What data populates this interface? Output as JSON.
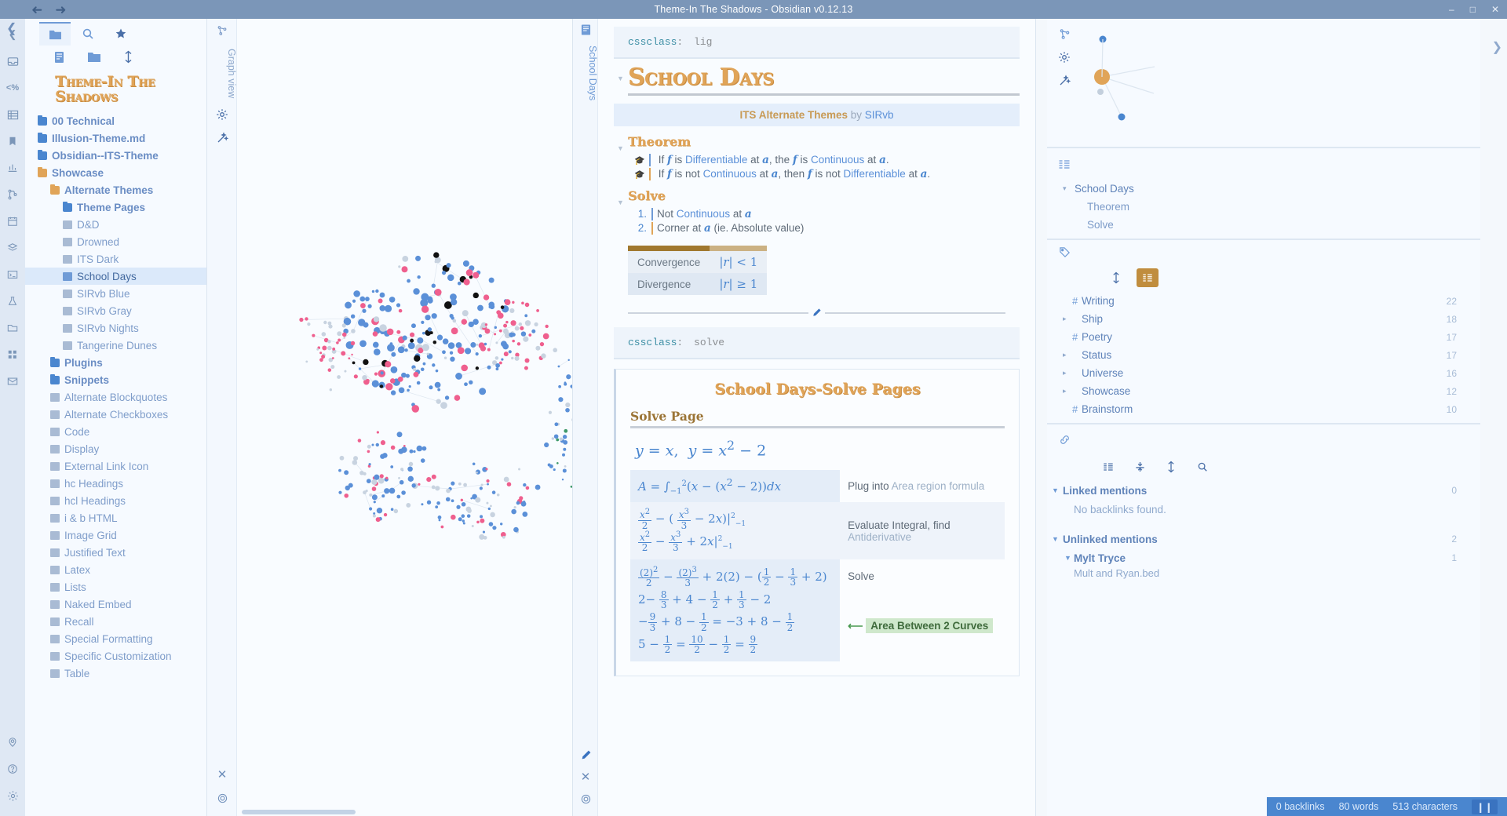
{
  "window": {
    "title": "Theme-In The Shadows - Obsidian v0.12.13",
    "back_icon": "back-arrow-icon",
    "forward_icon": "forward-arrow-icon",
    "minimize": "–",
    "maximize": "□",
    "close": "✕"
  },
  "ribbon": {
    "icons": [
      "chevron-left-icon",
      "inbox-icon",
      "percent-icon",
      "table-icon",
      "bookmark-icon",
      "chart-icon",
      "branch-icon",
      "calendar-icon",
      "layers-icon",
      "terminal-icon",
      "flask-icon",
      "folder-open-icon",
      "grid-icon",
      "mail-icon",
      "pin-icon",
      "help-icon",
      "settings-icon"
    ]
  },
  "explorer": {
    "tabs": [
      "folder-icon",
      "search-icon",
      "star-icon"
    ],
    "tools": [
      "new-note-icon",
      "new-folder-icon",
      "sort-icon"
    ],
    "vault_title": "Theme-In The Shadows",
    "tree": [
      {
        "label": "00 Technical",
        "type": "folder",
        "depth": 0,
        "color": "blue"
      },
      {
        "label": "Illusion-Theme.md",
        "type": "folder",
        "depth": 0,
        "color": "blue"
      },
      {
        "label": "Obsidian--ITS-Theme",
        "type": "folder",
        "depth": 0,
        "color": "blue"
      },
      {
        "label": "Showcase",
        "type": "folder",
        "depth": 0,
        "color": "orange"
      },
      {
        "label": "Alternate Themes",
        "type": "folder",
        "depth": 1,
        "color": "orange"
      },
      {
        "label": "Theme Pages",
        "type": "folder",
        "depth": 2,
        "color": "blue"
      },
      {
        "label": "D&D",
        "type": "file",
        "depth": 2
      },
      {
        "label": "Drowned",
        "type": "file",
        "depth": 2
      },
      {
        "label": "ITS Dark",
        "type": "file",
        "depth": 2
      },
      {
        "label": "School Days",
        "type": "file",
        "depth": 2,
        "selected": true
      },
      {
        "label": "SIRvb Blue",
        "type": "file",
        "depth": 2
      },
      {
        "label": "SIRvb Gray",
        "type": "file",
        "depth": 2
      },
      {
        "label": "SIRvb Nights",
        "type": "file",
        "depth": 2
      },
      {
        "label": "Tangerine Dunes",
        "type": "file",
        "depth": 2
      },
      {
        "label": "Plugins",
        "type": "folder",
        "depth": 1,
        "color": "blue"
      },
      {
        "label": "Snippets",
        "type": "folder",
        "depth": 1,
        "color": "blue"
      },
      {
        "label": "Alternate Blockquotes",
        "type": "file",
        "depth": 1
      },
      {
        "label": "Alternate Checkboxes",
        "type": "file",
        "depth": 1
      },
      {
        "label": "Code",
        "type": "file",
        "depth": 1
      },
      {
        "label": "Display",
        "type": "file",
        "depth": 1
      },
      {
        "label": "External Link Icon",
        "type": "file",
        "depth": 1
      },
      {
        "label": "hc Headings",
        "type": "file",
        "depth": 1
      },
      {
        "label": "hcl Headings",
        "type": "file",
        "depth": 1
      },
      {
        "label": "i & b HTML",
        "type": "file",
        "depth": 1
      },
      {
        "label": "Image Grid",
        "type": "file",
        "depth": 1
      },
      {
        "label": "Justified Text",
        "type": "file",
        "depth": 1
      },
      {
        "label": "Latex",
        "type": "file",
        "depth": 1
      },
      {
        "label": "Lists",
        "type": "file",
        "depth": 1
      },
      {
        "label": "Naked Embed",
        "type": "file",
        "depth": 1
      },
      {
        "label": "Recall",
        "type": "file",
        "depth": 1
      },
      {
        "label": "Special Formatting",
        "type": "file",
        "depth": 1
      },
      {
        "label": "Specific Customization",
        "type": "file",
        "depth": 1
      },
      {
        "label": "Table",
        "type": "file",
        "depth": 1
      }
    ]
  },
  "graph_pane": {
    "tab_label": "Graph view",
    "icons": [
      "graph-icon",
      "settings-gear-icon",
      "magic-wand-icon"
    ],
    "bottom_icons": [
      "close-icon",
      "pin-icon"
    ]
  },
  "editor": {
    "tab_label": "School Days",
    "tab_icon": "document-icon",
    "bottom_icons": [
      "edit-pencil-icon",
      "close-icon",
      "pin-icon"
    ],
    "frontmatter": {
      "key": "cssclass",
      "sep": ":",
      "value": "lig"
    },
    "title": "School Days",
    "byline": {
      "pre": "ITS Alternate Themes",
      "by": "by",
      "author": "SIRvb"
    },
    "theorem_heading": "Theorem",
    "theorem_items": [
      {
        "parts": [
          "If ",
          "f",
          " is ",
          "Differentiable",
          " at ",
          "a",
          ", the ",
          "f",
          " is ",
          "Continuous",
          " at ",
          "a",
          "."
        ]
      },
      {
        "parts": [
          "If ",
          "f",
          " is not ",
          "Continuous",
          " at ",
          "a",
          ", then ",
          "f",
          " is not ",
          "Differentiable",
          " at ",
          "a",
          "."
        ]
      }
    ],
    "solve_heading": "Solve",
    "solve_items": [
      {
        "num": "1.",
        "text_pre": "Not ",
        "link": "Continuous",
        "text_mid": " at ",
        "var": "a",
        "text_post": ""
      },
      {
        "num": "2.",
        "text_pre": "Corner at ",
        "link": "",
        "text_mid": "",
        "var": "a",
        "text_post": " (ie. Absolute value)"
      }
    ],
    "conv_table": {
      "rows": [
        {
          "label": "Convergence",
          "math": "|r| < 1"
        },
        {
          "label": "Divergence",
          "math": "|r| ≥ 1"
        }
      ]
    },
    "frontmatter2": {
      "key": "cssclass",
      "sep": ":",
      "value": "solve"
    },
    "solve_page": {
      "title": "School Days-Solve Pages",
      "subtitle": "Solve Page",
      "equation": "y = x, y = x² − 2",
      "steps": [
        {
          "math": "A = ∫₁² (x − (x² − 2))dx",
          "desc_pre": "Plug into ",
          "desc_dim": "Area region formula",
          "desc_post": ""
        },
        {
          "math_l1": "x²/2 − ( x³/3 − 2x )|₋₁²",
          "math_l2": "x²/2 − x³/3 + 2x|₋₁²",
          "desc_pre": "Evaluate Integral, find ",
          "desc_dim": "Antiderivative",
          "desc_post": ""
        },
        {
          "l1": "(2)²/2 − (2)³/3 + 2(2) − (½ − ⅓ + 2)",
          "l2": "2 − 8/3 + 4 − ½ + ⅓ − 2",
          "l3": "− 9/3 + 8 − ½ = −3 + 8 − ½",
          "l4": "5 − ½ = 10/2 − ½ = 9/2",
          "desc": "Solve",
          "badge_arrow": "⟵",
          "badge": "Area Between 2 Curves"
        }
      ]
    }
  },
  "right_sidebar": {
    "top_icons": [
      "graph-icon",
      "settings-gear-icon",
      "magic-wand-icon"
    ],
    "outline_icon": "outline-icon",
    "outline": [
      {
        "label": "School Days",
        "level": 0,
        "tri": "▾"
      },
      {
        "label": "Theorem",
        "level": 1,
        "tri": ""
      },
      {
        "label": "Solve",
        "level": 1,
        "tri": ""
      }
    ],
    "tag_icon": "tag-icon",
    "tag_tools": [
      "sort-icon",
      "nest-icon"
    ],
    "tags": [
      {
        "name": "Writing",
        "count": "22",
        "glyph": "#",
        "tri": ""
      },
      {
        "name": "Ship",
        "count": "18",
        "glyph": "",
        "tri": "▸"
      },
      {
        "name": "Poetry",
        "count": "17",
        "glyph": "#",
        "tri": ""
      },
      {
        "name": "Status",
        "count": "17",
        "glyph": "",
        "tri": "▸"
      },
      {
        "name": "Universe",
        "count": "16",
        "glyph": "",
        "tri": "▸"
      },
      {
        "name": "Showcase",
        "count": "12",
        "glyph": "",
        "tri": "▸"
      },
      {
        "name": "Brainstorm",
        "count": "10",
        "glyph": "#",
        "tri": ""
      }
    ],
    "backlink_icon": "link-icon",
    "backlink_tools": [
      "list-icon",
      "collapse-icon",
      "sort-icon",
      "search-icon"
    ],
    "linked_mentions": {
      "label": "Linked mentions",
      "count": "0",
      "empty": "No backlinks found."
    },
    "unlinked_mentions": {
      "label": "Unlinked mentions",
      "count": "2"
    },
    "unlinked_files": [
      {
        "name": "Mylt Tryce",
        "count": "1"
      },
      {
        "name": "Mult and Ryan.bed",
        "count": ""
      }
    ]
  },
  "status_bar": {
    "backlinks": "0 backlinks",
    "words": "80 words",
    "characters": "513 characters",
    "pause_icon": "pause-icon"
  },
  "graph_colors": {
    "blue": "#5b90d8",
    "pink": "#ef5f8e",
    "black": "#111111",
    "grey": "#c8d3e0",
    "orange": "#e0a458",
    "link": "#dde6f0"
  }
}
